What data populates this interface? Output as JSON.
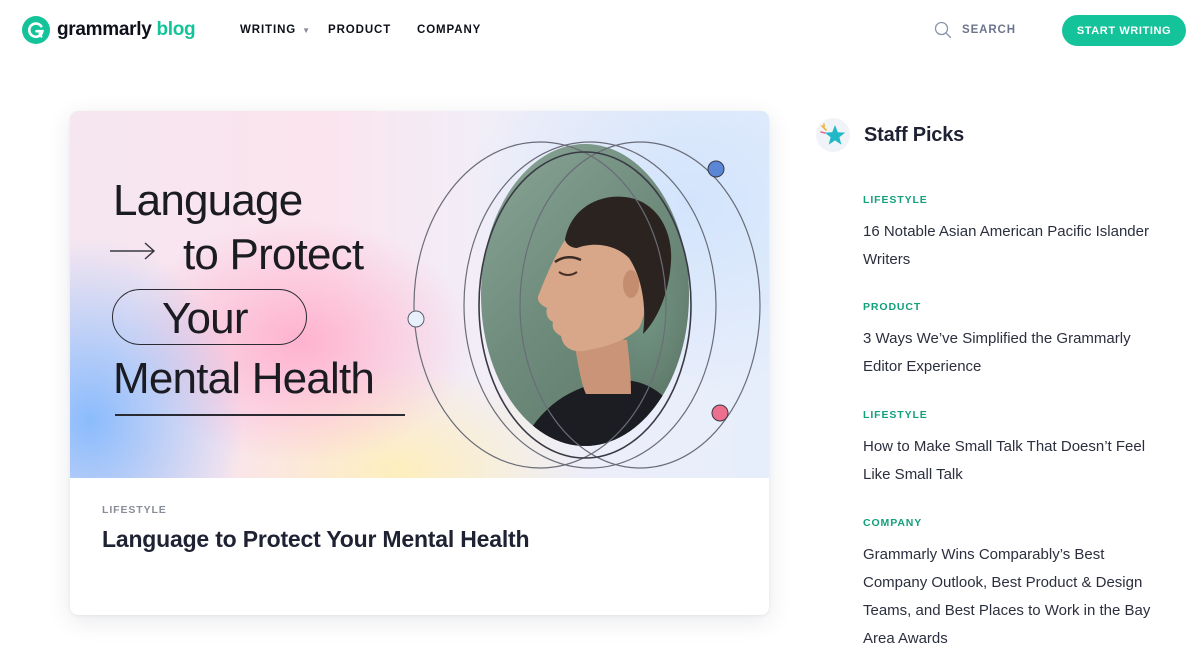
{
  "header": {
    "logo_text": "grammarly",
    "logo_blog": "blog",
    "nav": {
      "writing": "WRITING",
      "product": "PRODUCT",
      "company": "COMPANY"
    },
    "search_label": "SEARCH",
    "cta_label": "START WRITING"
  },
  "featured": {
    "hero_lines": [
      "Language",
      "to Protect",
      "Your",
      "Mental Health"
    ],
    "category": "LIFESTYLE",
    "title": "Language to Protect Your Mental Health"
  },
  "staff_picks": {
    "heading": "Staff Picks",
    "items": [
      {
        "category": "LIFESTYLE",
        "title": "16 Notable Asian American Pacific Islander Writers"
      },
      {
        "category": "PRODUCT",
        "title": "3 Ways We’ve Simplified the Grammarly Editor Experience"
      },
      {
        "category": "LIFESTYLE",
        "title": "How to Make Small Talk That Doesn’t Feel Like Small Talk"
      },
      {
        "category": "COMPANY",
        "title": "Grammarly Wins Comparably’s Best Company Outlook, Best Product & Design Teams, and Best Places to Work in the Bay Area Awards"
      }
    ]
  },
  "colors": {
    "brand_green": "#15c39a",
    "category_green": "#15a07d",
    "text_dark": "#1f2233",
    "muted": "#8a8d99"
  },
  "icons": [
    "grammarly-logo-icon",
    "chevron-down-icon",
    "search-icon",
    "star-icon"
  ]
}
